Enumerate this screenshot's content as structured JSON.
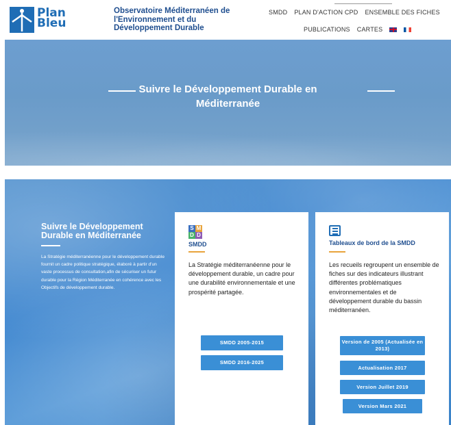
{
  "header": {
    "logo": {
      "line1": "Plan",
      "line2": "Bleu"
    },
    "org_name": "Observatoire Méditerranéen de l'Environnement et du Développement Durable",
    "nav_row1": [
      "SMDD",
      "PLAN D'ACTION CPD",
      "ENSEMBLE DES FICHES"
    ],
    "nav_row2": [
      "PUBLICATIONS",
      "CARTES"
    ],
    "flags": [
      "flag-uk-icon",
      "flag-fr-icon"
    ]
  },
  "hero": {
    "title_line1": "Suivre le Développement Durable en",
    "title_line2": "Méditerranée"
  },
  "intro": {
    "title": "Suivre le Développement Durable en Méditerranée",
    "text": "La Stratégie méditerranéenne pour le développement durable fournit un cadre politique stratégique, élaboré à partir d'un vaste processus de consultation,afin de sécuriser un futur durable pour la Région Méditerranée en cohérence avec les Objectifs de développement durable."
  },
  "cards": {
    "smdd": {
      "logo_letters": [
        "S",
        "M",
        "D",
        "D"
      ],
      "title": "SMDD",
      "text": "La Stratégie méditerranéenne pour le développement durable, un cadre pour une durabilité environnementale et une prospérité partagée.",
      "buttons": [
        "SMDD 2005-2015",
        "SMDD 2016-2025"
      ]
    },
    "tableaux": {
      "title": "Tableaux de bord de la SMDD",
      "text": "Les recueils regroupent un ensemble de fiches sur des indicateurs illustrant différentes problématiques environnementales et de développement durable du bassin méditerranéen.",
      "buttons": [
        "Version de 2005 (Actualisée en 2013)",
        "Actualisation 2017",
        "Version Juillet 2019",
        "Version Mars 2021"
      ]
    }
  },
  "colors": {
    "brand_blue": "#1f6db5",
    "button_blue": "#3a8fd6",
    "accent_orange": "#e8a33a"
  }
}
